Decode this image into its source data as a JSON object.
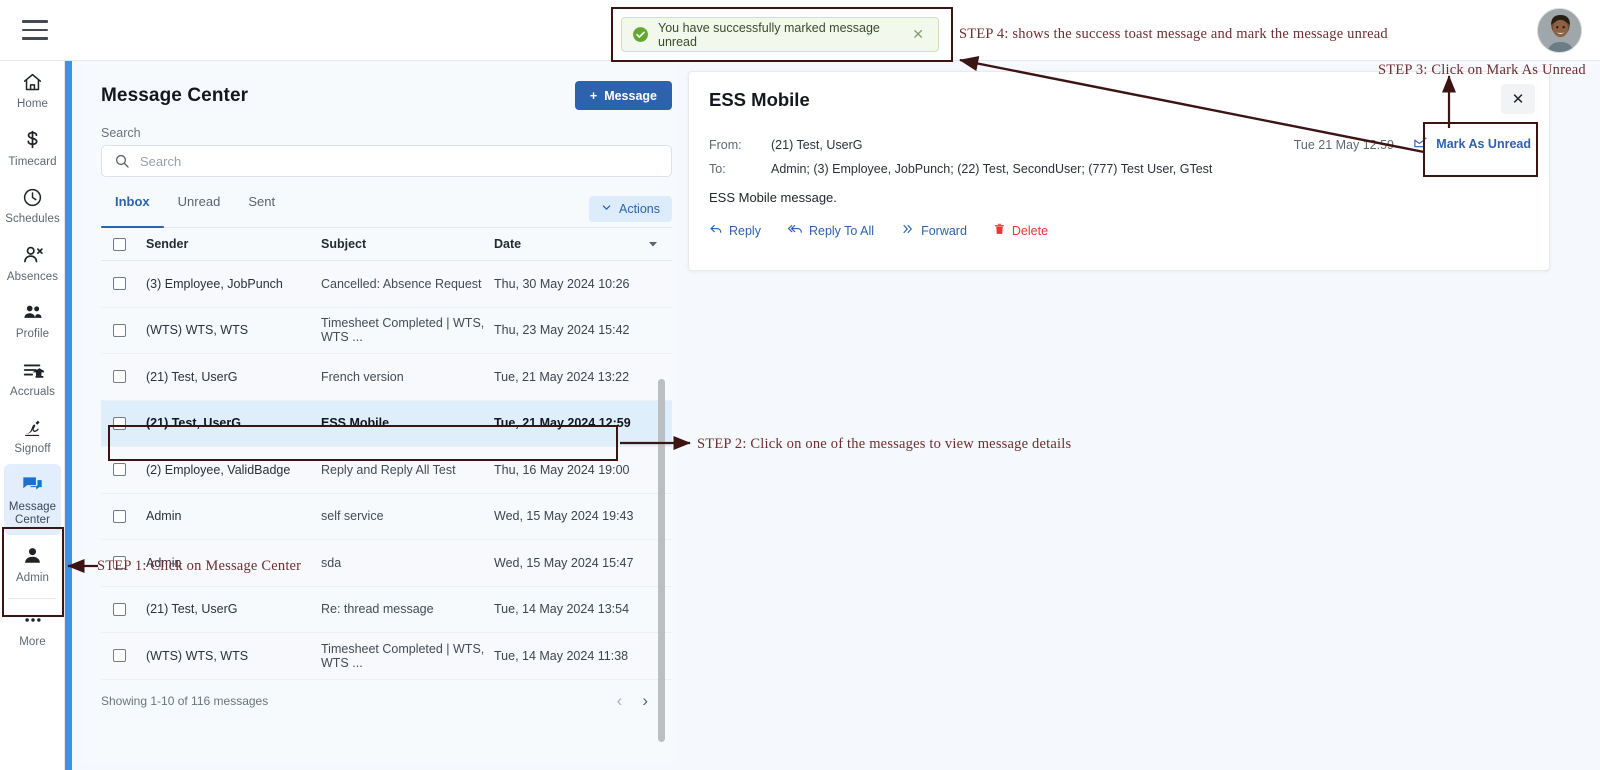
{
  "topbar": {
    "menu_icon": "hamburger-icon",
    "avatar_icon": "user-avatar"
  },
  "sidebar": {
    "items": [
      {
        "label": "Home",
        "icon": "home-icon",
        "active": false
      },
      {
        "label": "Timecard",
        "icon": "dollar-icon",
        "active": false
      },
      {
        "label": "Schedules",
        "icon": "clock-icon",
        "active": false
      },
      {
        "label": "Absences",
        "icon": "user-x-icon",
        "active": false
      },
      {
        "label": "Profile",
        "icon": "people-icon",
        "active": false
      },
      {
        "label": "Accruals",
        "icon": "list-bank-icon",
        "active": false
      },
      {
        "label": "Signoff",
        "icon": "signature-icon",
        "active": false
      },
      {
        "label": "Message Center",
        "icon": "chat-icon",
        "active": true
      },
      {
        "label": "Admin",
        "icon": "person-icon",
        "active": false
      },
      {
        "label": "More",
        "icon": "ellipsis-icon",
        "active": false
      }
    ]
  },
  "main": {
    "page_title": "Message Center",
    "new_message_button": "Message",
    "new_message_plus": "+",
    "search": {
      "label": "Search",
      "placeholder": "Search",
      "value": ""
    },
    "tabs": [
      {
        "label": "Inbox",
        "active": true
      },
      {
        "label": "Unread",
        "active": false
      },
      {
        "label": "Sent",
        "active": false
      }
    ],
    "actions_button": "Actions",
    "table": {
      "columns": [
        "Sender",
        "Subject",
        "Date"
      ],
      "rows": [
        {
          "sender": "(3) Employee, JobPunch",
          "subject": "Cancelled: Absence Request",
          "date": "Thu, 30 May 2024 10:26",
          "selected": false
        },
        {
          "sender": "(WTS) WTS, WTS",
          "subject": "Timesheet Completed | WTS, WTS ...",
          "date": "Thu, 23 May 2024 15:42",
          "selected": false
        },
        {
          "sender": "(21) Test, UserG",
          "subject": "French version",
          "date": "Tue, 21 May 2024 13:22",
          "selected": false
        },
        {
          "sender": "(21) Test, UserG",
          "subject": "ESS Mobile",
          "date": "Tue, 21 May 2024 12:59",
          "selected": true
        },
        {
          "sender": "(2) Employee, ValidBadge",
          "subject": "Reply and Reply All Test",
          "date": "Thu, 16 May 2024 19:00",
          "selected": false
        },
        {
          "sender": "Admin",
          "subject": "self service",
          "date": "Wed, 15 May 2024 19:43",
          "selected": false
        },
        {
          "sender": "Admin",
          "subject": "sda",
          "date": "Wed, 15 May 2024 15:47",
          "selected": false
        },
        {
          "sender": "(21) Test, UserG",
          "subject": "Re: thread message",
          "date": "Tue, 14 May 2024 13:54",
          "selected": false
        },
        {
          "sender": "(WTS) WTS, WTS",
          "subject": "Timesheet Completed | WTS, WTS ...",
          "date": "Tue, 14 May 2024 11:38",
          "selected": false
        }
      ]
    },
    "footer": {
      "showing": "Showing 1-10 of 116 messages",
      "prev": "‹",
      "next": "›"
    }
  },
  "detail": {
    "title": "ESS Mobile",
    "close_label": "✕",
    "from_label": "From:",
    "from_value": "(21) Test, UserG",
    "to_label": "To:",
    "to_value": "Admin;  (3) Employee, JobPunch;  (22) Test, SecondUser;  (777) Test User, GTest",
    "date": "Tue 21 May 12:59",
    "mark_unread": "Mark As Unread",
    "body": "ESS Mobile message.",
    "actions": [
      {
        "label": "Reply",
        "icon": "reply-icon",
        "danger": false
      },
      {
        "label": "Reply To All",
        "icon": "reply-all-icon",
        "danger": false
      },
      {
        "label": "Forward",
        "icon": "forward-icon",
        "danger": false
      },
      {
        "label": "Delete",
        "icon": "trash-icon",
        "danger": true
      }
    ]
  },
  "toast": {
    "message": "You have successfully marked message unread",
    "close": "✕"
  },
  "annotations": [
    {
      "id": "step1",
      "text": "STEP 1: Click on Message Center"
    },
    {
      "id": "step2",
      "text": "STEP 2: Click on one of the messages to view message details"
    },
    {
      "id": "step3",
      "text": "STEP 3: Click on Mark As Unread"
    },
    {
      "id": "step4",
      "text": "STEP 4: shows the success toast message and mark the message unread"
    }
  ],
  "colors": {
    "accent_blue": "#2d62ad",
    "sidebar_active_bg": "#e3eefc",
    "selected_row_bg": "#dfeefb",
    "toast_bg": "#f2f8eb",
    "toast_border": "#cfe3b5",
    "danger_red": "#e53935",
    "annotation": "#6d2f2f",
    "accent_strip": "#4290e2"
  }
}
